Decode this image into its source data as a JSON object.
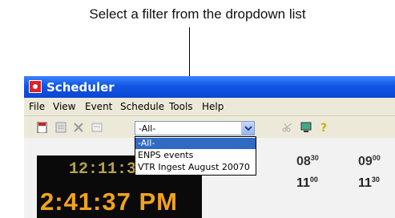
{
  "callout": {
    "text": "Select a filter from the dropdown list"
  },
  "window": {
    "title": "Scheduler"
  },
  "menu": [
    "File",
    "View",
    "Event",
    "Schedule",
    "Tools",
    "Help"
  ],
  "filter": {
    "selected": "-All-",
    "options": [
      "-All-",
      "ENPS events",
      "VTR Ingest August 20070"
    ]
  },
  "clock": {
    "small": "12:11:3",
    "big": "2:41:37 PM"
  },
  "timeline": [
    {
      "top_hour": "08",
      "top_min": "30",
      "bottom_hour": "11",
      "bottom_min": "00"
    },
    {
      "top_hour": "09",
      "top_min": "00",
      "bottom_hour": "11",
      "bottom_min": "30"
    }
  ],
  "colors": {
    "titlebar": "#0a46d4",
    "selection": "#316ac5",
    "clock_big": "#f2a31b",
    "clock_small": "#b8a24a"
  }
}
